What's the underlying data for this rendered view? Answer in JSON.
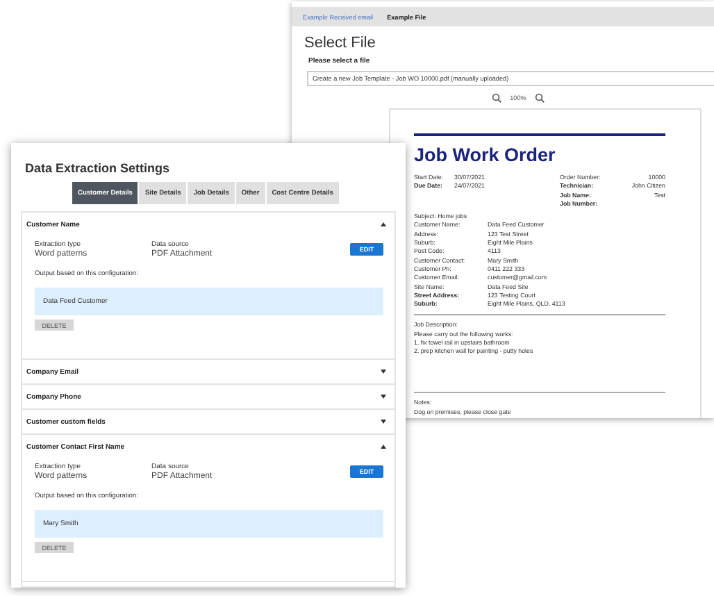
{
  "file_window": {
    "tabs": [
      {
        "label": "Example Received email",
        "selected": false
      },
      {
        "label": "Example File",
        "selected": true
      }
    ],
    "title": "Select File",
    "file_label": "Please select a file",
    "file_select": {
      "value": "Create a new Job Template - Job WO 10000.pdf (manually uploaded)"
    },
    "zoom_level": "100%",
    "document": {
      "title": "Job Work Order",
      "header_left": [
        {
          "label": "Start Date:",
          "value": "30/07/2021",
          "bold": false
        },
        {
          "label": "Due Date:",
          "value": "24/07/2021",
          "bold": true
        }
      ],
      "header_right": [
        {
          "label": "Order Number:",
          "value": "10000",
          "bold": false
        },
        {
          "label": "Technician:",
          "value": "John Citizen",
          "bold": true
        },
        {
          "label": "Job Name:",
          "value": "Test",
          "bold": true
        },
        {
          "label": "Job Number:",
          "bold": true
        }
      ],
      "subject": "Subject: Home jobs",
      "fields": [
        {
          "label": "Customer Name:",
          "value": "Data Feed Customer",
          "bold": false
        },
        {
          "label": "Address:",
          "value": "123 Test Street",
          "bold": false
        },
        {
          "label": "Suburb:",
          "value": "Eight Mile Plains",
          "bold": false
        },
        {
          "label": "Post Code:",
          "value": "4113",
          "bold": false
        },
        {
          "label": "Customer Contact:",
          "value": "Mary Smith",
          "bold": false
        },
        {
          "label": "Customer Ph:",
          "value": "0411 222 333",
          "bold": false
        },
        {
          "label": "Customer Email:",
          "value": "customer@gmail.com",
          "bold": false
        },
        {
          "label": "Site Name:",
          "value": "Data Feed Site",
          "bold": false
        },
        {
          "label": "Street Address:",
          "value": "123 Testing Court",
          "bold": true
        },
        {
          "label": "Suburb:",
          "value": "Eight Mile Plains, QLD, 4113",
          "bold": true
        }
      ],
      "description_label": "Job Description:",
      "description_lines": [
        "Please carry out the following works:",
        "1. fix towel rail in upstairs bathroom",
        "2. prep kitchen wall for painting - putty holes"
      ],
      "notes_label": "Notes:",
      "notes": "Dog on premises, please close gate"
    }
  },
  "settings_panel": {
    "title": "Data Extraction Settings",
    "tabs": [
      {
        "label": "Customer Details",
        "selected": true
      },
      {
        "label": "Site Details",
        "selected": false
      },
      {
        "label": "Job Details",
        "selected": false
      },
      {
        "label": "Other",
        "selected": false
      },
      {
        "label": "Cost Centre Details",
        "selected": false
      }
    ],
    "sections": [
      {
        "title": "Customer Name",
        "expanded": true,
        "extraction_type_label": "Extraction type",
        "extraction_type": "Word patterns",
        "data_source_label": "Data source",
        "data_source": "PDF Attachment",
        "edit_button": "EDIT",
        "output_label": "Output based on this configuration:",
        "output": "Data Feed Customer",
        "delete_button": "DELETE"
      },
      {
        "title": "Company Email",
        "expanded": false
      },
      {
        "title": "Company Phone",
        "expanded": false
      },
      {
        "title": "Customer custom fields",
        "expanded": false
      },
      {
        "title": "Customer Contact First Name",
        "expanded": true,
        "extraction_type_label": "Extraction type",
        "extraction_type": "Word patterns",
        "data_source_label": "Data source",
        "data_source": "PDF Attachment",
        "edit_button": "EDIT",
        "output_label": "Output based on this configuration:",
        "output": "Mary Smith",
        "delete_button": "DELETE"
      }
    ]
  }
}
